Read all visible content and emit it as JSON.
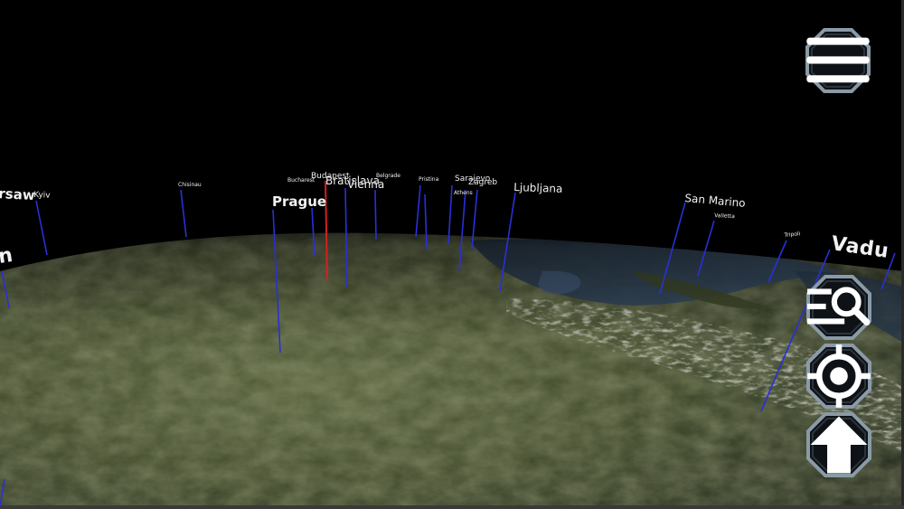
{
  "scene": {
    "cities": [
      {
        "id": "warsaw",
        "name": "Warsaw",
        "display": "rsaw"
      },
      {
        "id": "kyiv",
        "name": "Kyiv"
      },
      {
        "id": "partial-left",
        "name": "n"
      },
      {
        "id": "chisinau",
        "name": "Chisinau"
      },
      {
        "id": "bucharest",
        "name": "Bucharest"
      },
      {
        "id": "budapest",
        "name": "Budapest"
      },
      {
        "id": "bratislava",
        "name": "Bratislava"
      },
      {
        "id": "vienna",
        "name": "Vienna"
      },
      {
        "id": "belgrade",
        "name": "Belgrade"
      },
      {
        "id": "prague",
        "name": "Prague"
      },
      {
        "id": "pristina",
        "name": "Pristina"
      },
      {
        "id": "sarajevo",
        "name": "Sarajevo"
      },
      {
        "id": "zagreb",
        "name": "Zagreb"
      },
      {
        "id": "athens",
        "name": "Athens"
      },
      {
        "id": "ljubljana",
        "name": "Ljubljana"
      },
      {
        "id": "san-marino",
        "name": "San Marino"
      },
      {
        "id": "valletta",
        "name": "Valletta"
      },
      {
        "id": "tripoli",
        "name": "Tripoli"
      },
      {
        "id": "vaduz",
        "name": "Vaduz",
        "display": "Vadu"
      }
    ]
  },
  "controls": {
    "menu": {
      "icon": "hamburger-menu-icon"
    },
    "search": {
      "icon": "list-search-icon"
    },
    "locate": {
      "icon": "target-locate-icon"
    },
    "north": {
      "icon": "arrow-up-icon"
    }
  },
  "colors": {
    "background": "#000000",
    "terrain": "#3b4428",
    "water": "#2b3a4e",
    "pin_line": "#2a2fd8",
    "selected_pin_line": "#d42020",
    "label_text": "#f2f2f2",
    "button_fill": "#101418",
    "button_border": "#8a9aa6"
  }
}
